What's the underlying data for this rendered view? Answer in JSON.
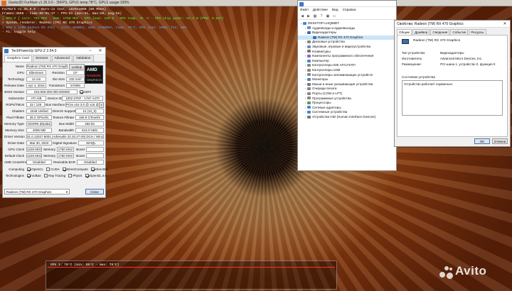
{
  "furmark": {
    "window_title": "Geeks3D FurMark v1.35.0.0 - 35FPS, GPU1 temp:78°C, GPU1 usage:100%",
    "overlay_lines": [
      "FurMark v1.35.0.0 - Burn-in test, 1920x1080 (0X MSAA)",
      "Frames:4856 - time:00:01:17 - FPS:51 (min:51, max:58, avg:52)",
      "[ GPU-Z ] core: 701 MHz - mem: 1750 MHz - GPU load: 100 % - GPU temp: 78 °C - GPU chip power: 93.3 W (PPW: 0.547)",
      "> OpenGL renderer: Radeon (TM) RX 470 Graphics",
      "> GPU 1 (AMD Radeon RX 470) - core: 686MHz, mem: 1750MHz, temp: 78°C, GPU load: 100%, fan: 68%",
      "- F1: toggle help"
    ],
    "graph_label": "GPU 1: 78°C (min: 58°C - max: 78°C)"
  },
  "watermark": {
    "brand": "Avito"
  },
  "gpuz": {
    "title": "TechPowerUp GPU-Z 2.54.0",
    "tabs": [
      "Graphics Card",
      "Sensors",
      "Advanced",
      "Validation"
    ],
    "active_tab": "Graphics Card",
    "rows": {
      "name_label": "Name",
      "name_value": "Radeon (TM) RX 470 Graphics",
      "lookup_label": "Lookup",
      "gpu_label": "GPU",
      "gpu_value": "Ellesmere",
      "revision_label": "Revision",
      "revision_value": "CF",
      "technology_label": "Technology",
      "technology_value": "14 nm",
      "die_size_label": "Die Size",
      "die_size_value": "232 mm²",
      "release_label": "Release Date",
      "release_value": "Apr 4, 2016",
      "transistors_label": "Transistors",
      "transistors_value": "5700M",
      "bios_label": "BIOS Version",
      "bios_value": "015.050.000.000.000000",
      "uefi_label": "UEFI",
      "subvendor_label": "Subvendor",
      "subvendor_value": "ATI AIB",
      "device_id_label": "Device ID",
      "device_id_value": "1002 67DF - 1787 A470",
      "rops_label": "ROPs/TMUs",
      "rops_value": "32 / 128",
      "bus_label": "Bus Interface",
      "bus_value": "PCIe x16 3.0 @ x16 2.0",
      "bus_help": "?",
      "shaders_label": "Shaders",
      "shaders_value": "2048 Unified",
      "dx_label": "DirectX Support",
      "dx_value": "12 (12_0)",
      "pixel_label": "Pixel Fillrate",
      "pixel_value": "39.2 GPixel/s",
      "texture_label": "Texture Fillrate",
      "texture_value": "156.9 GTexel/s",
      "memtype_label": "Memory Type",
      "memtype_value": "GDDR5 (Elpida)",
      "buswidth_label": "Bus Width",
      "buswidth_value": "256 bit",
      "memsize_label": "Memory Size",
      "memsize_value": "4096 MB",
      "bandwidth_label": "Bandwidth",
      "bandwidth_value": "224.0 GB/s",
      "driver_label": "Driver Version",
      "driver_value": "31.0.12027.9001 (Adrenalin 22.20.27.09) DCH / Win10 64",
      "driverdate_label": "Driver Date",
      "driverdate_value": "Mar 30, 2023",
      "sig_label": "Digital Signature",
      "sig_value": "WHQL",
      "gpuclock_label": "GPU Clock",
      "gpuclock_value": "1226 MHz",
      "memclock_label": "Memory",
      "memclock_value": "1750 MHz",
      "boost_label": "Boost",
      "defclock_label": "Default Clock",
      "defclock_value": "1226 MHz",
      "defmem_label": "Memory",
      "defmem_value": "1750 MHz",
      "defboost_label": "Boost",
      "crossfire_label": "AMD CrossFire",
      "crossfire_value": "Disabled",
      "rebar_label": "Resizable BAR",
      "rebar_value": "Disabled",
      "computing_label": "Computing",
      "technologies_label": "Technologies"
    },
    "computing": [
      {
        "label": "OpenCL",
        "checked": true
      },
      {
        "label": "CUDA",
        "checked": false
      },
      {
        "label": "DirectCompute",
        "checked": true
      },
      {
        "label": "DirectML",
        "checked": true
      }
    ],
    "technologies": [
      {
        "label": "Vulkan",
        "checked": true
      },
      {
        "label": "Ray Tracing",
        "checked": false
      },
      {
        "label": "PhysX",
        "checked": false
      },
      {
        "label": "OpenGL 4.6",
        "checked": true
      }
    ],
    "selected_card": "Radeon (TM) RX 470 Graphics",
    "close_label": "Close"
  },
  "devmgr": {
    "menu": [
      "Файл",
      "Действие",
      "Вид",
      "Справка"
    ],
    "root": "DESKTOP-LHQ58BT",
    "items": [
      {
        "label": "Аудиовходы и аудиовыходы",
        "level": 1,
        "expanded": false,
        "color": "#6a8fc0"
      },
      {
        "label": "Видеоадаптеры",
        "level": 1,
        "expanded": true,
        "color": "#3a6fb0"
      },
      {
        "label": "Radeon (TM) RX 470 Graphics",
        "level": 2,
        "expanded": null,
        "color": "#3a6fb0"
      },
      {
        "label": "Дисковые устройства",
        "level": 1,
        "expanded": false,
        "color": "#888888"
      },
      {
        "label": "Звуковые, игровые и видеоустройства",
        "level": 1,
        "expanded": false,
        "color": "#6a8fc0"
      },
      {
        "label": "Клавиатуры",
        "level": 1,
        "expanded": false,
        "color": "#777777"
      },
      {
        "label": "Компоненты программного обеспечения",
        "level": 1,
        "expanded": false,
        "color": "#8a6ac0"
      },
      {
        "label": "Компьютер",
        "level": 1,
        "expanded": false,
        "color": "#4a88c8"
      },
      {
        "label": "Контроллеры IDE ATA/ATAPI",
        "level": 1,
        "expanded": false,
        "color": "#888888"
      },
      {
        "label": "Контроллеры USB",
        "level": 1,
        "expanded": false,
        "color": "#888888"
      },
      {
        "label": "Контроллеры запоминающих устройств",
        "level": 1,
        "expanded": false,
        "color": "#888888"
      },
      {
        "label": "Мониторы",
        "level": 1,
        "expanded": false,
        "color": "#4a88c8"
      },
      {
        "label": "Мыши и иные указывающие устройства",
        "level": 1,
        "expanded": false,
        "color": "#777777"
      },
      {
        "label": "Очереди печати",
        "level": 1,
        "expanded": false,
        "color": "#888888"
      },
      {
        "label": "Порты (COM и LPT)",
        "level": 1,
        "expanded": false,
        "color": "#888888"
      },
      {
        "label": "Программные устройства",
        "level": 1,
        "expanded": false,
        "color": "#888888"
      },
      {
        "label": "Процессоры",
        "level": 1,
        "expanded": false,
        "color": "#5a9a5a"
      },
      {
        "label": "Сетевые адаптеры",
        "level": 1,
        "expanded": false,
        "color": "#4a88c8"
      },
      {
        "label": "Системные устройства",
        "level": 1,
        "expanded": false,
        "color": "#4a88c8"
      },
      {
        "label": "Устройства HID (Human Interface Devices)",
        "level": 1,
        "expanded": false,
        "color": "#777777"
      }
    ]
  },
  "props": {
    "title": "Свойства: Radeon (TM) RX 470 Graphics",
    "tabs": [
      "Общие",
      "Драйвер",
      "Сведения",
      "События",
      "Ресурсы"
    ],
    "active_tab": "Общие",
    "device_name": "Radeon (TM) RX 470 Graphics",
    "type_label": "Тип устройства:",
    "type_value": "Видеоадаптеры",
    "maker_label": "Изготовитель:",
    "maker_value": "Advanced Micro Devices, Inc.",
    "location_label": "Размещение:",
    "location_value": "PCI-шина 1, устройство 0, функция 0",
    "status_label": "Состояние устройства",
    "status_text": "Устройство работает нормально.",
    "ok_label": "OK",
    "cancel_label": "Отмена"
  }
}
